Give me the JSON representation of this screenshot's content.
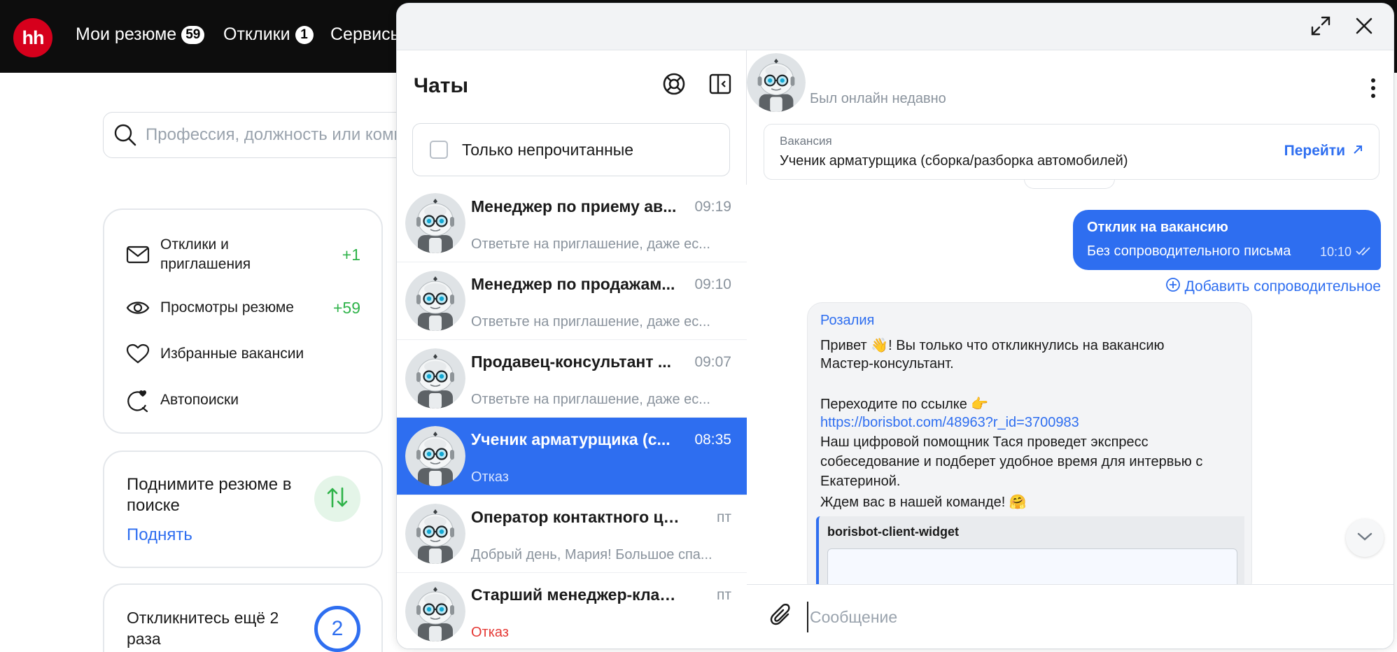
{
  "header": {
    "logo": "hh",
    "nav": [
      {
        "label": "Мои резюме",
        "badge": "59"
      },
      {
        "label": "Отклики",
        "badge": "1"
      },
      {
        "label": "Сервисы",
        "badge": ""
      }
    ]
  },
  "search": {
    "placeholder": "Профессия, должность или компания"
  },
  "sidebar": {
    "items": [
      {
        "label": "Отклики и приглашения",
        "count": "+1",
        "icon": "envelope-icon"
      },
      {
        "label": "Просмотры резюме",
        "count": "+59",
        "icon": "eye-icon"
      },
      {
        "label": "Избранные вакансии",
        "count": "",
        "icon": "heart-icon"
      },
      {
        "label": "Автопоиски",
        "count": "",
        "icon": "autosearch-icon"
      }
    ]
  },
  "lift_card": {
    "title": "Поднимите резюме в поиске",
    "link": "Поднять"
  },
  "respond_card": {
    "title": "Откликнитесь ещё 2 раза",
    "count": "2"
  },
  "chats": {
    "title": "Чаты",
    "unread_filter_label": "Только непрочитанные",
    "items": [
      {
        "name": "Менеджер по приему ав...",
        "time": "09:19",
        "preview": "Ответьте на приглашение, даже ес...",
        "active": false,
        "preview_status": "normal"
      },
      {
        "name": "Менеджер по продажам...",
        "time": "09:10",
        "preview": "Ответьте на приглашение, даже ес...",
        "active": false,
        "preview_status": "normal"
      },
      {
        "name": "Продавец-консультант ...",
        "time": "09:07",
        "preview": "Ответьте на приглашение, даже ес...",
        "active": false,
        "preview_status": "normal"
      },
      {
        "name": "Ученик арматурщика (с...",
        "time": "08:35",
        "preview": "Отказ",
        "active": true,
        "preview_status": "normal"
      },
      {
        "name": "Оператор контактного цен...",
        "time": "пт",
        "preview": "Добрый день, Мария! Большое спа...",
        "active": false,
        "preview_status": "normal"
      },
      {
        "name": "Старший менеджер-кладо...",
        "time": "пт",
        "preview": "Отказ",
        "active": false,
        "preview_status": "red"
      }
    ]
  },
  "conversation": {
    "status": "Был онлайн недавно",
    "vacancy": {
      "label": "Вакансия",
      "name": "Ученик арматурщика (сборка/разборка автомобилей)",
      "go_label": "Перейти"
    },
    "my_message": {
      "title": "Отклик на вакансию",
      "text": "Без сопроводительного письма",
      "time": "10:10"
    },
    "add_cover_label": "Добавить сопроводительное",
    "incoming": {
      "sender": "Розалия",
      "lines": [
        "Привет 👋! Вы только что откликнулись на вакансию",
        "Мастер-консультант.",
        "",
        "Переходите по ссылке 👉",
        "https://borisbot.com/48963?r_id=3700983",
        "Наш цифровой помощник Тася проведет экспресс",
        "собеседование и подберет удобное время для интервью с",
        "Екатериной.",
        "Ждем вас в нашей команде! 🤗"
      ],
      "widget_label": "borisbot-client-widget"
    },
    "composer_placeholder": "Сообщение"
  },
  "colors": {
    "accent": "#2e6ef0",
    "brand_red": "#d6001c",
    "positive": "#2fb34a",
    "negative": "#e53935"
  }
}
